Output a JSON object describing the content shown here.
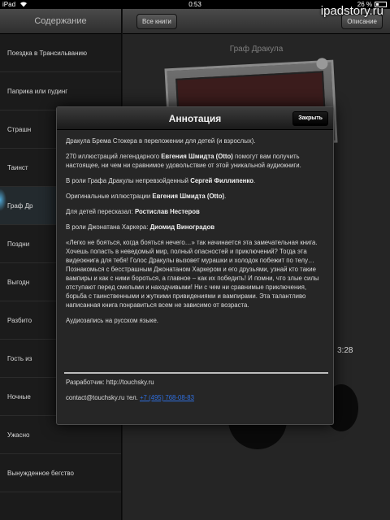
{
  "status_bar": {
    "device": "iPad",
    "time": "0:53",
    "battery": "26 %"
  },
  "watermark": "ipadstory.ru",
  "sidebar": {
    "title": "Содержание",
    "chapters": [
      {
        "label": "Поездка в Трансильванию"
      },
      {
        "label": "Паприка или пудинг"
      },
      {
        "label": "Страшн"
      },
      {
        "label": "Таинст"
      },
      {
        "label": "Граф Др"
      },
      {
        "label": "Поздни"
      },
      {
        "label": "Выгодн"
      },
      {
        "label": "Разбито"
      },
      {
        "label": "Гость из"
      },
      {
        "label": "Ночные"
      },
      {
        "label": "Ужасно"
      },
      {
        "label": "Вынужденное бегство"
      }
    ],
    "active_index": 4
  },
  "toolbar": {
    "all_books": "Все книги",
    "description": "Описание"
  },
  "book": {
    "title": "Граф Дракула"
  },
  "player": {
    "time": "3:28"
  },
  "modal": {
    "title": "Аннотация",
    "close": "Закрыть",
    "p1": "Дракула Брема Стокера в переложении для детей (и взрослых).",
    "p2_pre": "270 иллюстраций легендарного ",
    "p2_name": "Евгения Шмидта (Otto)",
    "p2_post": " помогут вам получить настоящее, ни чем ни сравнимое удовольствие от этой уникальной аудиокниги.",
    "p3_pre": "В роли Графа Дракулы непревзойденный ",
    "p3_name": "Сергей Филлипенко",
    "p3_post": ".",
    "p4_pre": "Оригинальные иллюстрации ",
    "p4_name": "Евгения Шмидта (Otto)",
    "p4_post": ".",
    "p5_pre": "Для детей пересказал: ",
    "p5_name": "Ростислав Нестеров",
    "p6_pre": "В роли Джонатана Харкера: ",
    "p6_name": "Диомид Виноградов",
    "p7": "«Легко не бояться, когда бояться нечего…» так начинается эта замечательная книга. Хочешь попасть в неведомый мир, полный опасностей и приключений? Тогда эта видеокнига для тебя! Голос Дракулы вызовет мурашки и холодок побежит по телу… Познакомься с бесстрашным Джонатаном Харкером и его друзьями, узнай кто такие вампиры и как с ними бороться, а главное – как их победить! И помни, что злые силы отступают перед смелыми и находчивыми! Ни с чем ни сравнимые приключения, борьба с таинственными и жуткими привидениями и вампирами. Эта талантливо написанная книга понравиться всем не зависимо от возраста.",
    "p8": "Аудиозапись на русском языке.",
    "developer": "Разработчик: http://touchsky.ru",
    "contact_pre": "contact@touchsky.ru тел. ",
    "phone": "+7 (495) 768-08-83"
  }
}
